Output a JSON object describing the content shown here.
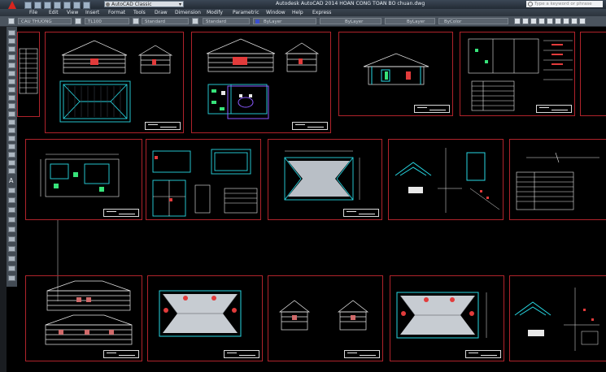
{
  "titlebar": {
    "workspace": "AutoCAD Classic",
    "title": "Autodesk AutoCAD 2014    HOAN CONG TOAN BO chuan.dwg",
    "search_placeholder": "Type a keyword or phrase"
  },
  "menu": [
    "File",
    "Edit",
    "View",
    "Insert",
    "Format",
    "Tools",
    "Draw",
    "Dimension",
    "Modify",
    "Parametric",
    "Window",
    "Help",
    "Express"
  ],
  "toolbar": {
    "layer": "CAU THUONG",
    "text_style": "TL100",
    "dim_style": "Standard",
    "table_style": "Standard",
    "color": "ByLayer",
    "linetype": "ByLayer",
    "lineweight": "ByLayer",
    "plot_style": "ByColor"
  },
  "left_toolbar_letter": "A",
  "colors": {
    "sheet_border": "#b0232b",
    "cyan": "#27d7e3",
    "white": "#e8e8e8",
    "red": "#e23b3b"
  }
}
